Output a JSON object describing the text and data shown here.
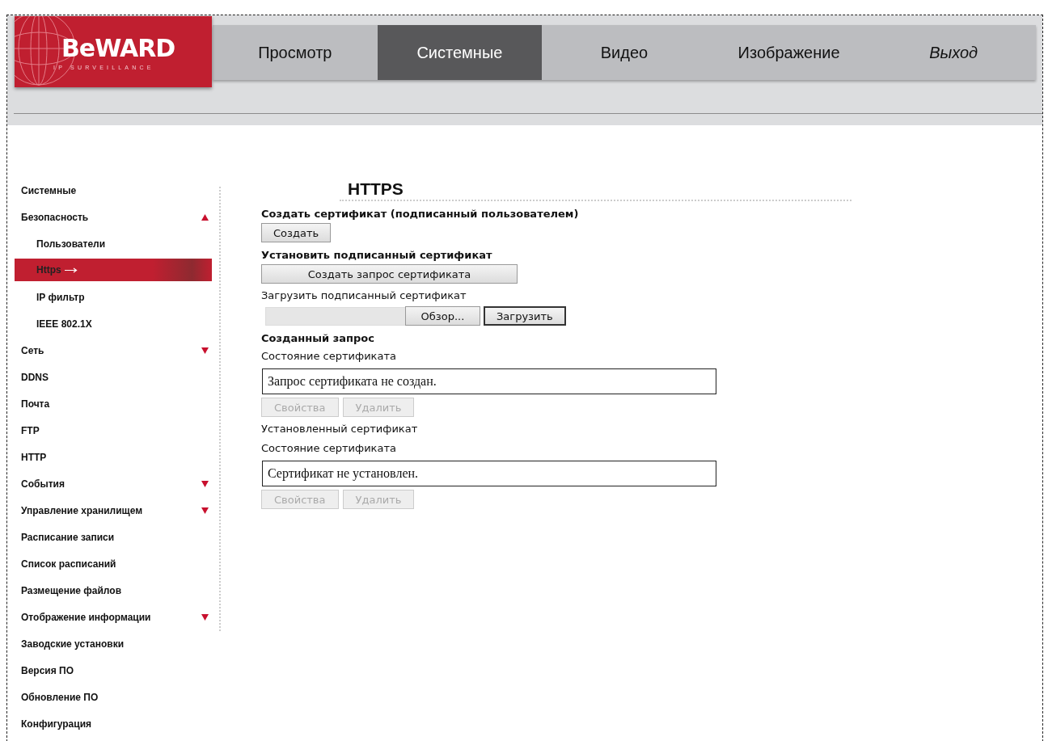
{
  "logo": {
    "brand": "BeWARD",
    "tagline": "IP SURVEILLANCE"
  },
  "nav": [
    {
      "label": "Просмотр",
      "selected": false,
      "kind": "normal"
    },
    {
      "label": "Системные",
      "selected": true,
      "kind": "normal"
    },
    {
      "label": "Видео",
      "selected": false,
      "kind": "normal"
    },
    {
      "label": "Изображение",
      "selected": false,
      "kind": "normal"
    },
    {
      "label": "Выход",
      "selected": false,
      "kind": "logout"
    }
  ],
  "sidebar": {
    "items": [
      {
        "label": "Системные",
        "kind": "link",
        "selected": false
      },
      {
        "label": "Безопасность",
        "kind": "section",
        "expanded": true,
        "selected": false,
        "children": [
          {
            "label": "Пользователи",
            "selected": false
          },
          {
            "label": "Https",
            "selected": true
          },
          {
            "label": "IP фильтр",
            "selected": false
          },
          {
            "label": "IEEE 802.1X",
            "selected": false
          }
        ]
      },
      {
        "label": "Сеть",
        "kind": "section",
        "expanded": false,
        "selected": false
      },
      {
        "label": "DDNS",
        "kind": "link",
        "selected": false
      },
      {
        "label": "Почта",
        "kind": "link",
        "selected": false
      },
      {
        "label": "FTP",
        "kind": "link",
        "selected": false
      },
      {
        "label": "HTTP",
        "kind": "link",
        "selected": false
      },
      {
        "label": "События",
        "kind": "section",
        "expanded": false,
        "selected": false
      },
      {
        "label": "Управление хранилищем",
        "kind": "section",
        "expanded": false,
        "selected": false
      },
      {
        "label": "Расписание записи",
        "kind": "link",
        "selected": false
      },
      {
        "label": "Список расписаний",
        "kind": "link",
        "selected": false
      },
      {
        "label": "Размещение файлов",
        "kind": "link",
        "selected": false
      },
      {
        "label": "Отображение информации",
        "kind": "section",
        "expanded": false,
        "selected": false
      },
      {
        "label": "Заводские установки",
        "kind": "link",
        "selected": false
      },
      {
        "label": "Версия ПО",
        "kind": "link",
        "selected": false
      },
      {
        "label": "Обновление ПО",
        "kind": "link",
        "selected": false
      },
      {
        "label": "Конфигурация",
        "kind": "link",
        "selected": false
      }
    ]
  },
  "content": {
    "title": "HTTPS",
    "blocks": [
      {
        "kind": "heading",
        "text": "Создать сертификат (подписанный пользователем)"
      },
      {
        "kind": "button",
        "label": "Создать",
        "wide": false
      },
      {
        "kind": "heading",
        "text": "Установить подписанный сертификат"
      },
      {
        "kind": "button",
        "label": "Создать запрос сертификата",
        "wide": true
      },
      {
        "kind": "label",
        "text": "Загрузить подписанный сертификат"
      },
      {
        "kind": "upload",
        "browse": "Обзор...",
        "upload": "Загрузить"
      },
      {
        "kind": "heading",
        "text": "Созданный запрос"
      },
      {
        "kind": "label",
        "text": "Состояние сертификата"
      },
      {
        "kind": "status",
        "text": "Запрос сертификата не создан."
      },
      {
        "kind": "actions",
        "buttons": [
          {
            "label": "Свойства",
            "disabled": true
          },
          {
            "label": "Удалить",
            "disabled": true
          }
        ]
      },
      {
        "kind": "label",
        "text": "Установленный сертификат"
      },
      {
        "kind": "label",
        "text": "Состояние сертификата"
      },
      {
        "kind": "status",
        "text": "Сертификат не установлен."
      },
      {
        "kind": "actions",
        "buttons": [
          {
            "label": "Свойства",
            "disabled": true
          },
          {
            "label": "Удалить",
            "disabled": true
          }
        ]
      }
    ]
  }
}
